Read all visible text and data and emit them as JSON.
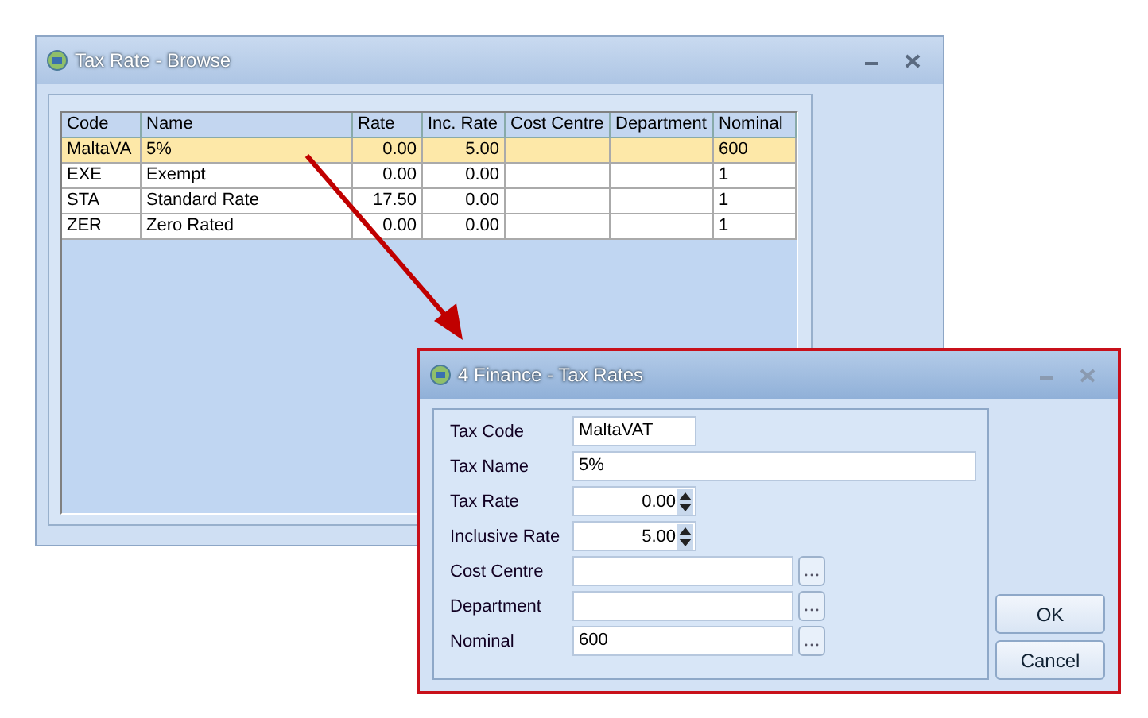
{
  "browse_window": {
    "title": "Tax Rate - Browse",
    "grid": {
      "columns": [
        "Code",
        "Name",
        "Rate",
        "Inc. Rate",
        "Cost Centre",
        "Department",
        "Nominal"
      ],
      "rows": [
        {
          "cells": [
            "MaltaVA",
            "5%",
            "0.00",
            "5.00",
            null,
            null,
            "600"
          ],
          "selected": true
        },
        {
          "cells": [
            "EXE",
            "Exempt",
            "0.00",
            "0.00",
            null,
            null,
            "1"
          ],
          "selected": false
        },
        {
          "cells": [
            "STA",
            "Standard Rate",
            "17.50",
            "0.00",
            null,
            null,
            "1"
          ],
          "selected": false
        },
        {
          "cells": [
            "ZER",
            "Zero Rated",
            "0.00",
            "0.00",
            null,
            null,
            "1"
          ],
          "selected": false
        }
      ]
    }
  },
  "dialog": {
    "title": "4 Finance - Tax Rates",
    "fields": [
      {
        "label": "Tax Code",
        "value": "MaltaVAT",
        "kind": "short"
      },
      {
        "label": "Tax Name",
        "value": "5%",
        "kind": "text"
      },
      {
        "label": "Tax Rate",
        "value": "0.00",
        "kind": "spin"
      },
      {
        "label": "Inclusive Rate",
        "value": "5.00",
        "kind": "spin"
      },
      {
        "label": "Cost Centre",
        "kind": "lookup"
      },
      {
        "label": "Department",
        "kind": "lookup"
      },
      {
        "label": "Nominal",
        "value": "600",
        "kind": "lookup"
      }
    ],
    "buttons": [
      "OK",
      "Cancel"
    ]
  }
}
